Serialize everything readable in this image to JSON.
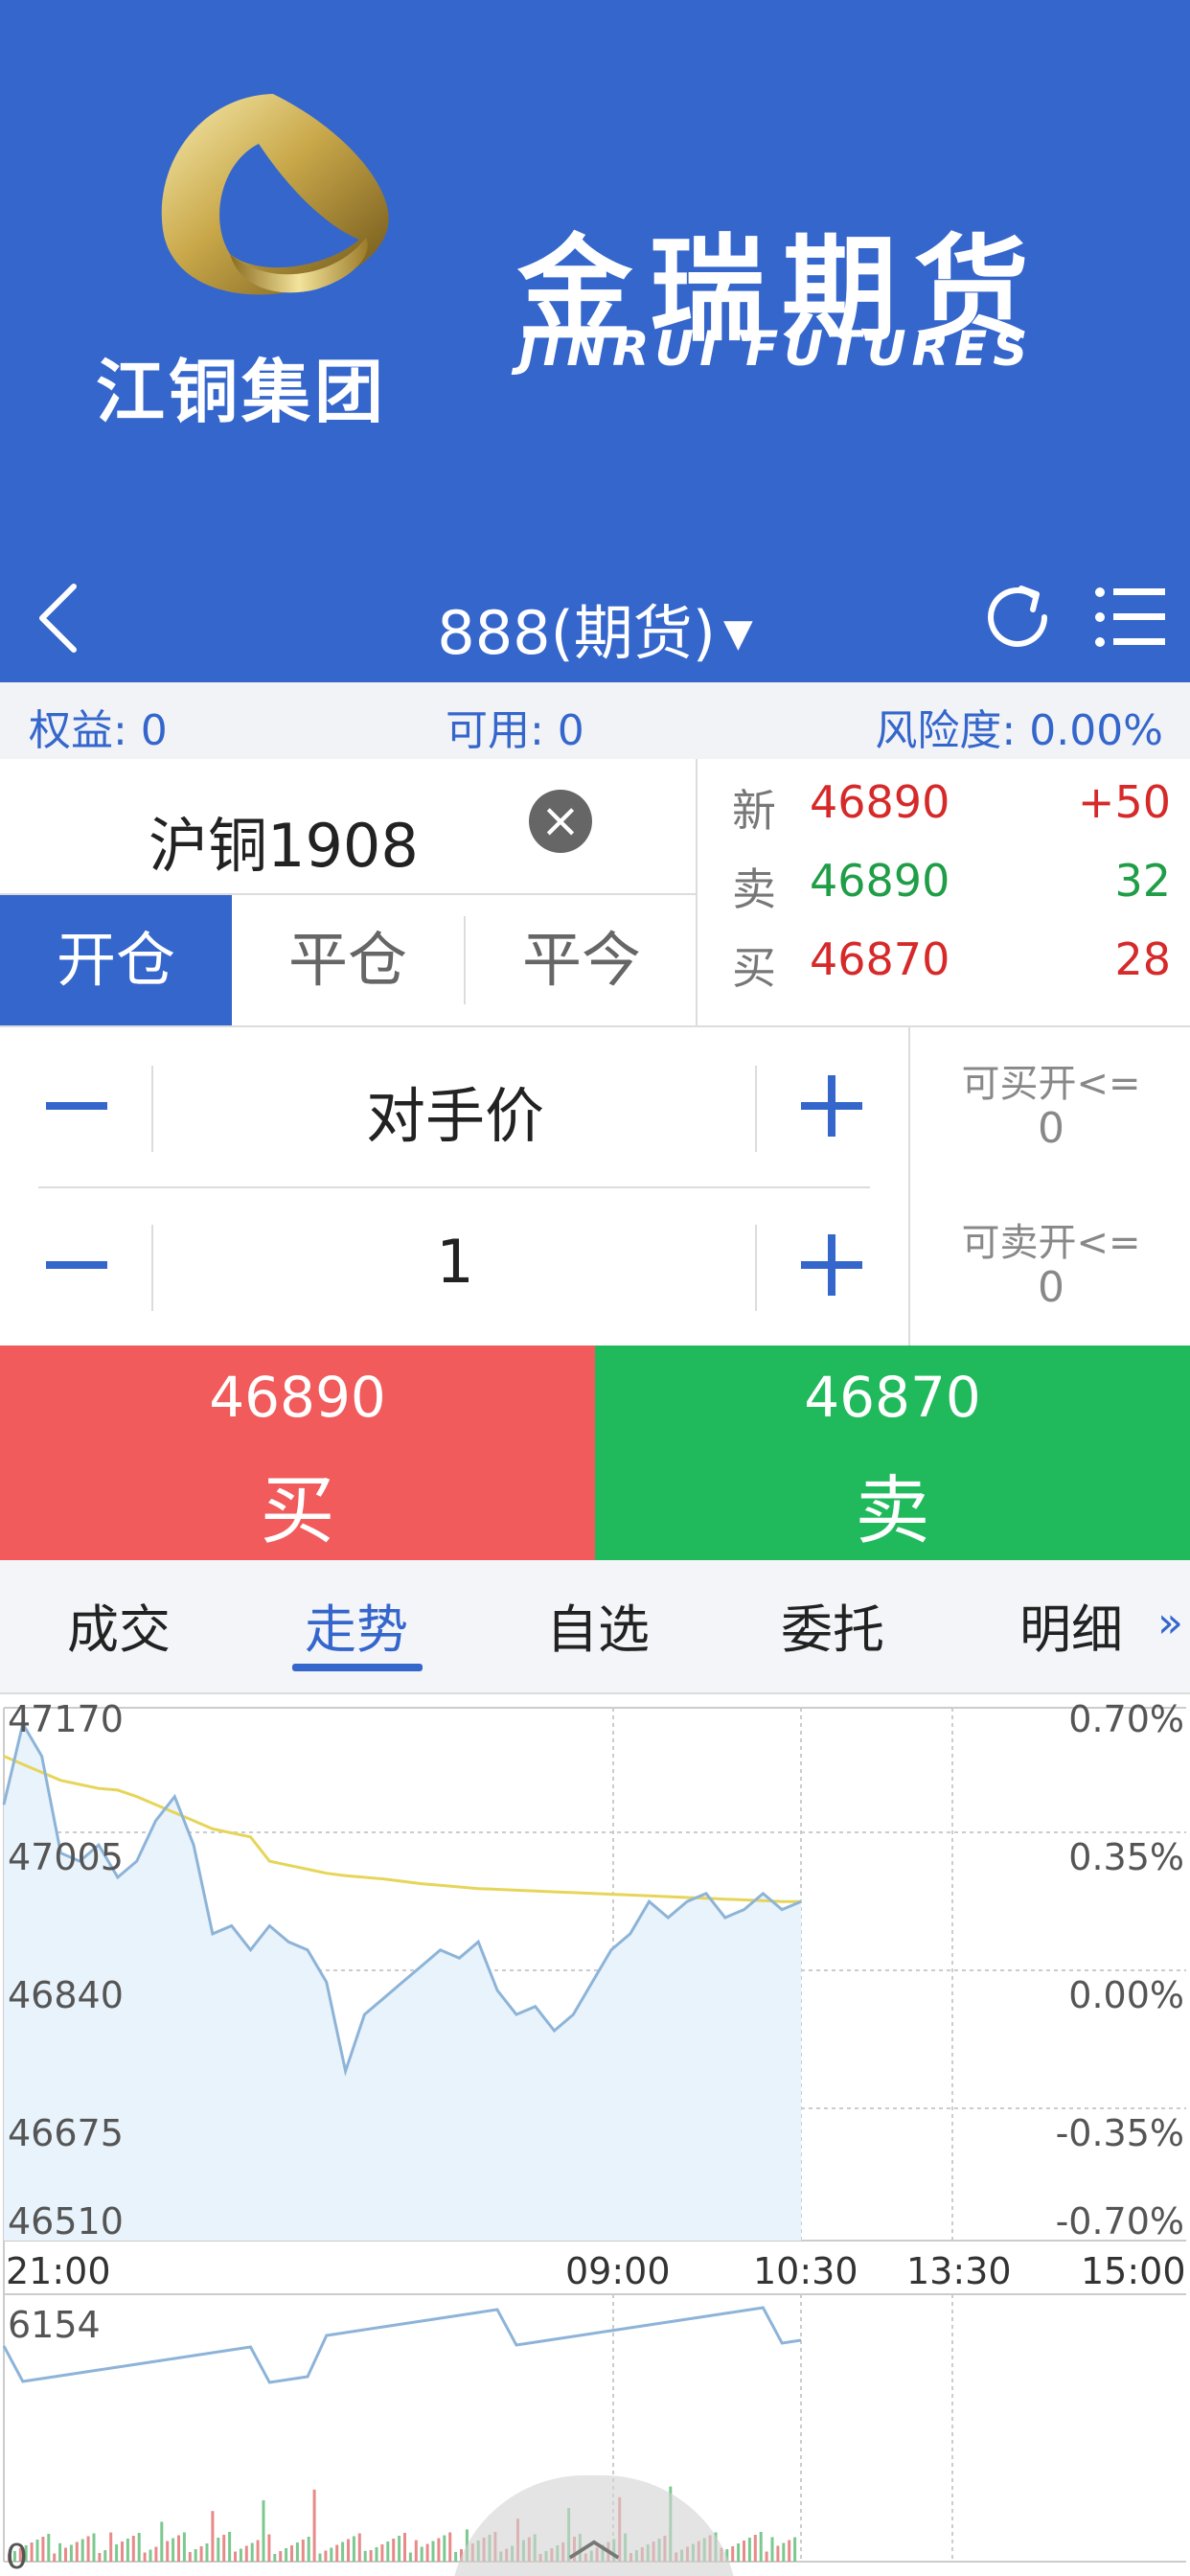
{
  "banner": {
    "group_name": "江铜集团",
    "company_cn": "金瑞期货",
    "company_en": "JINRUI FUTURES"
  },
  "nav": {
    "title": "888(期货)",
    "caret": "▼"
  },
  "account": {
    "equity": "权益: 0",
    "available": "可用: 0",
    "risk": "风险度:  0.00%"
  },
  "contract": {
    "name": "沪铜1908",
    "tabs": [
      "开仓",
      "平仓",
      "平今"
    ]
  },
  "quote": {
    "rows": [
      {
        "label": "新",
        "price": "46890",
        "value": "+50"
      },
      {
        "label": "卖",
        "price": "46890",
        "value": "32"
      },
      {
        "label": "买",
        "price": "46870",
        "value": "28"
      }
    ]
  },
  "order": {
    "price_mode": "对手价",
    "quantity": "1",
    "can_buy_label": "可买开<=",
    "can_buy_value": "0",
    "can_sell_label": "可卖开<=",
    "can_sell_value": "0"
  },
  "buy": {
    "price": "46890",
    "label": "买"
  },
  "sell": {
    "price": "46870",
    "label": "卖"
  },
  "bottom_tabs": {
    "items": [
      "成交",
      "走势",
      "自选",
      "委托",
      "明细"
    ],
    "active": "走势",
    "more": "»"
  },
  "chart_data": {
    "type": "line",
    "y_ticks_left": [
      "47170",
      "47005",
      "46840",
      "46675",
      "46510"
    ],
    "y_ticks_right": [
      "0.70%",
      "0.35%",
      "0.00%",
      "-0.35%",
      "-0.70%"
    ],
    "x_ticks": [
      "21:00",
      "09:00",
      "10:30",
      "13:30",
      "15:00"
    ],
    "ylim": [
      46510,
      47170
    ],
    "series": [
      {
        "values": [
          47050,
          47150,
          47110,
          46990,
          46980,
          47000,
          46960,
          46980,
          47030,
          47060,
          47000,
          46890,
          46900,
          46870,
          46900,
          46880,
          46870,
          46830,
          46720,
          46790,
          46810,
          46830,
          46850,
          46870,
          46860,
          46880,
          46820,
          46790,
          46800,
          46770,
          46790,
          46830,
          46870,
          46890,
          46930,
          46910,
          46930,
          46940,
          46910,
          46920,
          46940,
          46920,
          46930
        ]
      },
      {
        "values": [
          47110,
          47100,
          47090,
          47080,
          47075,
          47070,
          47068,
          47060,
          47050,
          47040,
          47030,
          47020,
          47015,
          47010,
          46980,
          46975,
          46970,
          46965,
          46962,
          46960,
          46958,
          46955,
          46952,
          46950,
          46948,
          46946,
          46945,
          46944,
          46943,
          46942,
          46941,
          46940,
          46939,
          46938,
          46937,
          46936,
          46935,
          46934,
          46933,
          46932,
          46931,
          46930,
          46930
        ]
      }
    ],
    "volume_label": "6154",
    "volume_min_label": "0"
  }
}
